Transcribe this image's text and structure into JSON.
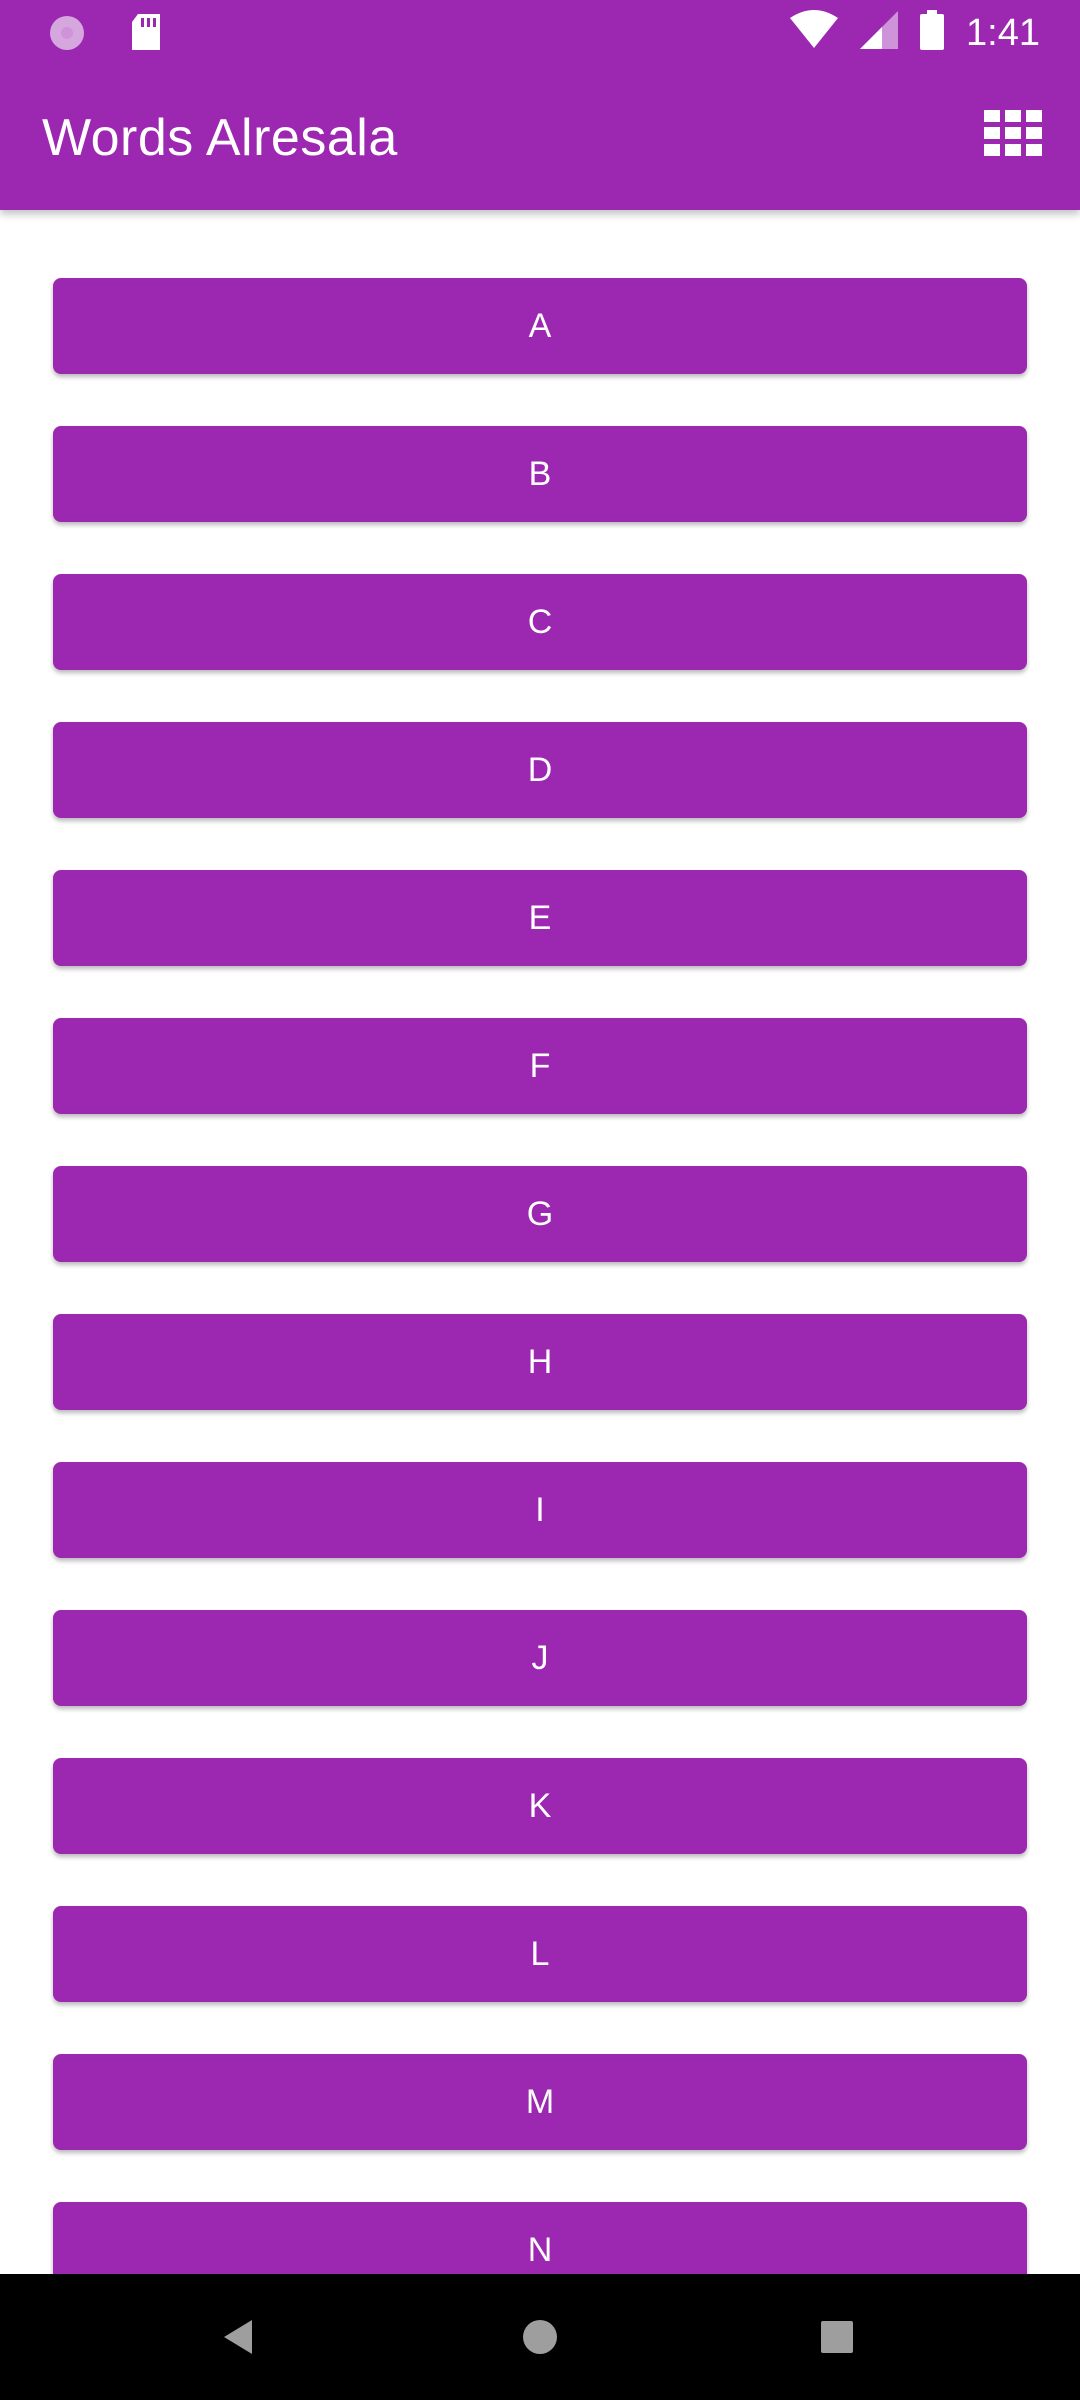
{
  "status_bar": {
    "time": "1:41",
    "icons": [
      "loading-icon",
      "sd-card-icon",
      "wifi-icon",
      "signal-icon",
      "battery-icon"
    ]
  },
  "app_bar": {
    "title": "Words Alresala",
    "action_icon": "grid-view-icon"
  },
  "letters": [
    "A",
    "B",
    "C",
    "D",
    "E",
    "F",
    "G",
    "H",
    "I",
    "J",
    "K",
    "L",
    "M",
    "N"
  ],
  "navigation": [
    "back-icon",
    "home-icon",
    "recents-icon"
  ],
  "colors": {
    "primary": "#9c27b0",
    "on_primary": "#ffffff",
    "background": "#ffffff",
    "nav_bar": "#000000"
  }
}
